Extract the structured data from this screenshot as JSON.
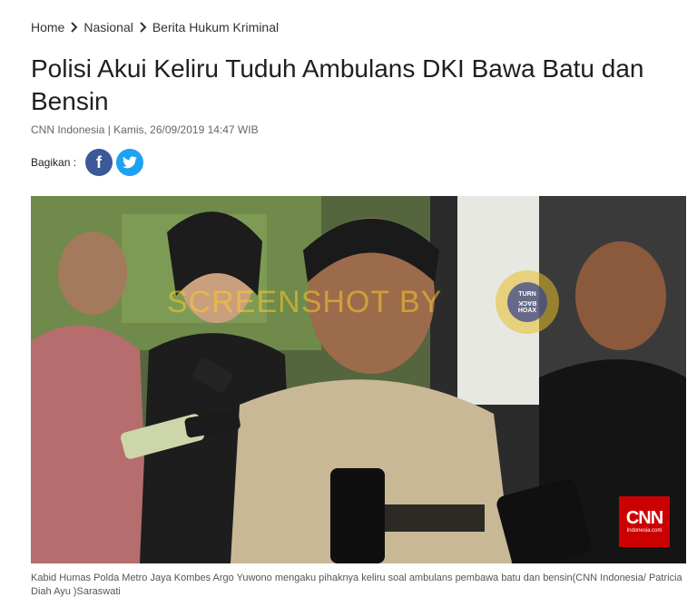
{
  "breadcrumb": {
    "home": "Home",
    "nasional": "Nasional",
    "section": "Berita Hukum Kriminal"
  },
  "article": {
    "title": "Polisi Akui Keliru Tuduh Ambulans DKI Bawa Batu dan Bensin",
    "source": "CNN Indonesia",
    "date": "Kamis, 26/09/2019 14:47 WIB",
    "meta_separator": " | "
  },
  "share": {
    "label": "Bagikan :",
    "facebook_icon": "facebook-icon",
    "twitter_icon": "twitter-icon"
  },
  "photo": {
    "watermark": "SCREENSHOT BY",
    "turnback_lines": [
      "TURN",
      "BACK",
      "HOAX"
    ],
    "cnn_logo": "CNN",
    "cnn_sub": "Indonesia.com",
    "caption": "Kabid Humas Polda Metro Jaya Kombes Argo Yuwono mengaku pihaknya keliru soal ambulans pembawa batu dan bensin(CNN Indonesia/ Patricia Diah Ayu )Saraswati"
  },
  "colors": {
    "facebook": "#3b5998",
    "twitter": "#1da1f2",
    "cnn_red": "#cc0000"
  }
}
